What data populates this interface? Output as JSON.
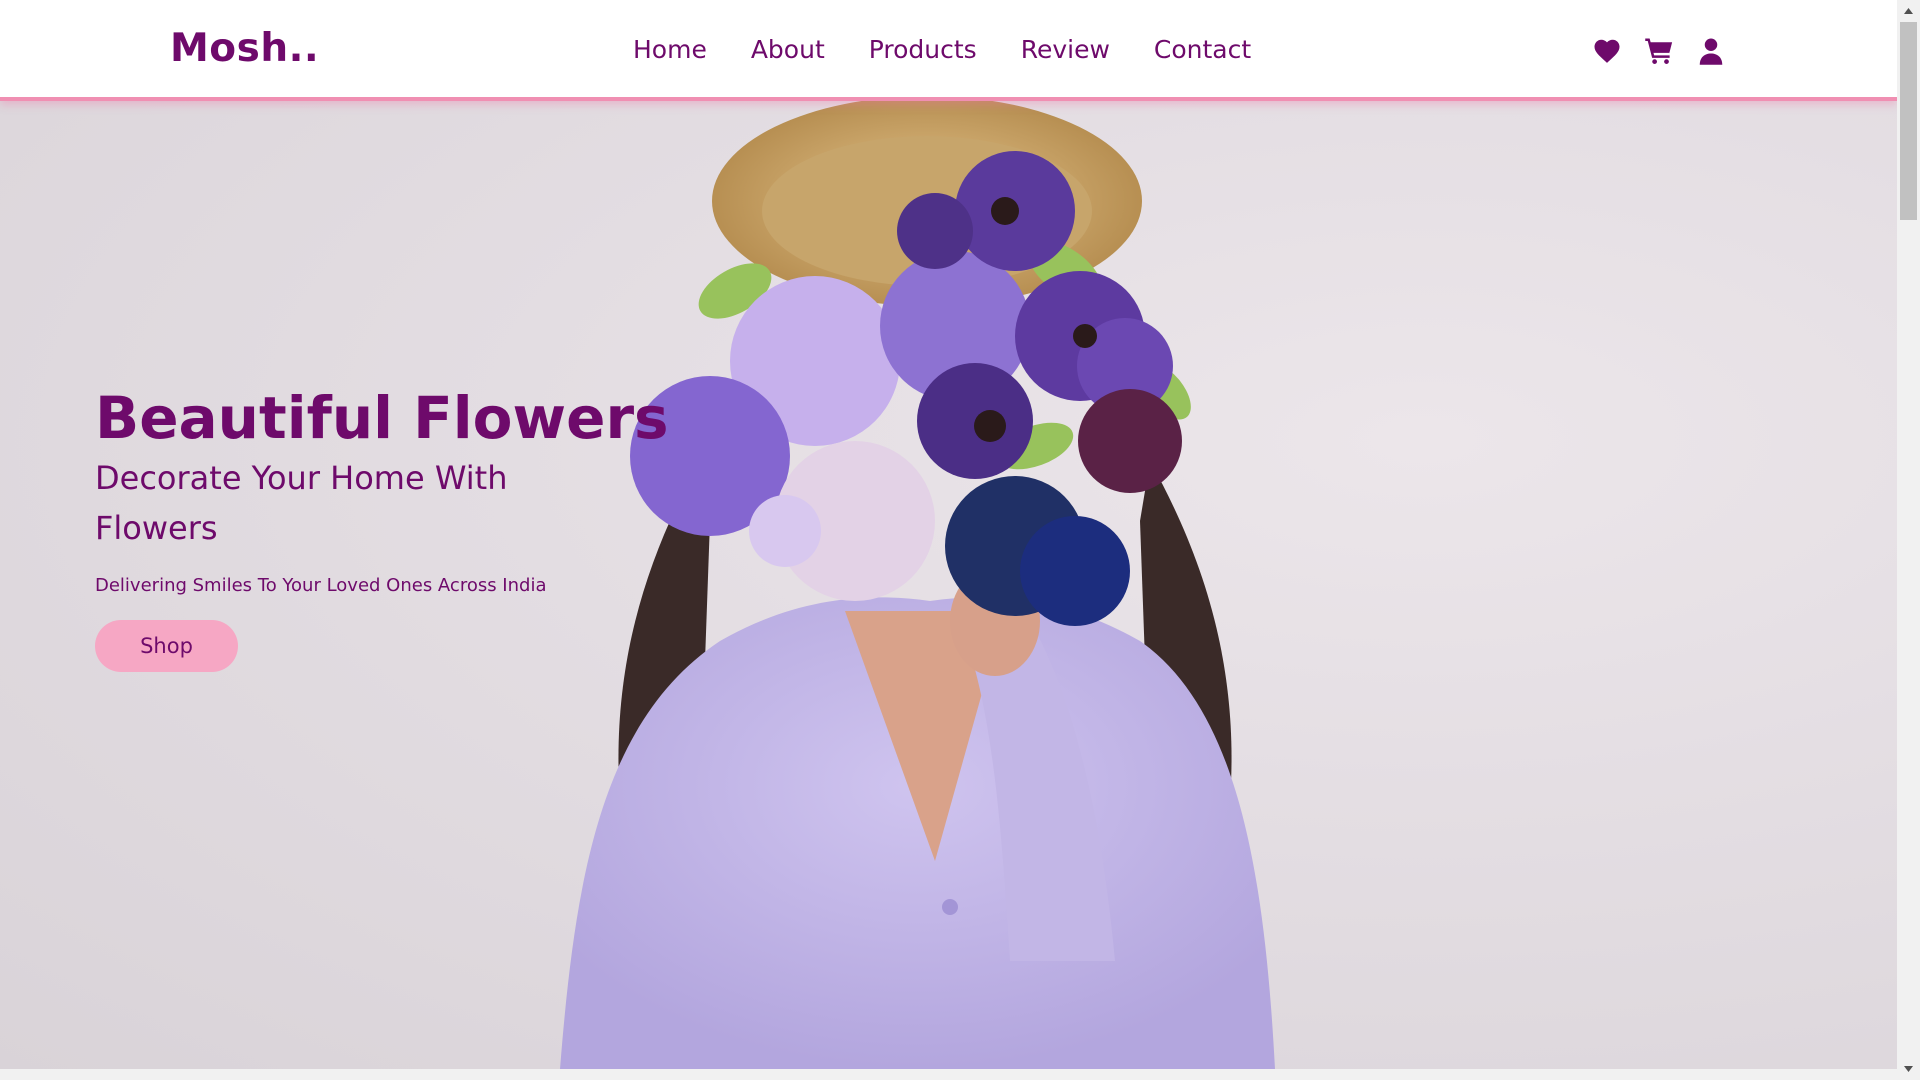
{
  "header": {
    "logo": "Mosh..",
    "nav": [
      "Home",
      "About",
      "Products",
      "Review",
      "Contact"
    ],
    "icons": [
      "heart-icon",
      "cart-icon",
      "user-icon"
    ]
  },
  "hero": {
    "title": "Beautiful Flowers",
    "subtitle": "Decorate Your Home With Flowers",
    "tagline": "Delivering Smiles To Your Loved Ones Across India",
    "button": "Shop"
  },
  "colors": {
    "brand": "#6e0a6b",
    "accent_pink": "#f6a7c4",
    "header_border": "#f08fb2"
  }
}
